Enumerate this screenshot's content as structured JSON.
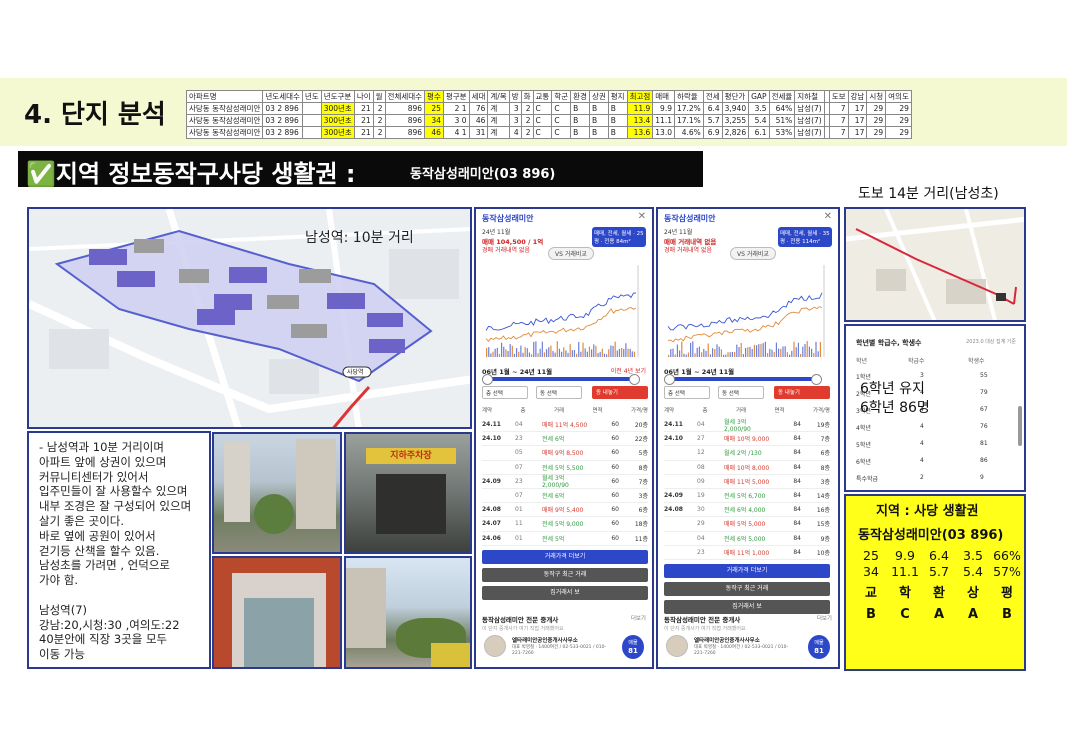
{
  "section_title": "4. 단지 분석",
  "table": {
    "headers": [
      "아파트명",
      "년도세대수",
      "년도",
      "년도구분",
      "나이",
      "월",
      "전체세대수",
      "평수",
      "평구분",
      "세대",
      "계/복",
      "방",
      "화",
      "교통",
      "학군",
      "환경",
      "상권",
      "평지",
      "최고점",
      "매매",
      "하락율",
      "전세",
      "평단가",
      "GAP",
      "전세율",
      "지하철",
      "",
      "도보",
      "강남",
      "시청",
      "여의도"
    ],
    "rows": [
      [
        "사당동 동작삼성래미안",
        "03 2 896",
        "",
        "300년초",
        "21",
        "2",
        "896",
        "25",
        "2 1",
        "76",
        "계",
        "3",
        "2",
        "C",
        "C",
        "B",
        "B",
        "B",
        "11.9",
        "9.9",
        "17.2%",
        "6.4",
        "3,940",
        "3.5",
        "64%",
        "남성(7)",
        "",
        "7",
        "17",
        "29",
        "29"
      ],
      [
        "사당동 동작삼성래미안",
        "03 2 896",
        "",
        "300년초",
        "21",
        "2",
        "896",
        "34",
        "3 0",
        "46",
        "계",
        "3",
        "2",
        "C",
        "C",
        "B",
        "B",
        "B",
        "13.4",
        "11.1",
        "17.1%",
        "5.7",
        "3,255",
        "5.4",
        "51%",
        "남성(7)",
        "",
        "7",
        "17",
        "29",
        "29"
      ],
      [
        "사당동 동작삼성래미안",
        "03 2 896",
        "",
        "300년초",
        "21",
        "2",
        "896",
        "46",
        "4 1",
        "31",
        "계",
        "4",
        "2",
        "C",
        "C",
        "B",
        "B",
        "B",
        "13.6",
        "13.0",
        "4.6%",
        "6.9",
        "2,826",
        "6.1",
        "53%",
        "남성(7)",
        "",
        "7",
        "17",
        "29",
        "29"
      ]
    ]
  },
  "subheader": {
    "main": "✅지역 정보동작구사당 생활권 :",
    "apt": "동작삼성래미안(03 896)"
  },
  "walk_label": "도보 14분 거리(남성초)",
  "map": {
    "station_label": "남성역: 10분 거리",
    "station_tag": "사당역"
  },
  "phones": [
    {
      "title": "동작삼성래미안",
      "date": "24년 11월",
      "price": "매매 104,500 / 1억",
      "sub": "경매 거래내역 없음",
      "pill": "매매, 전세, 월세 · 25평 · 전용 84m²",
      "vs": "VS 거래비교",
      "range": "06년 1월 ~ 24년 11월",
      "range_right": "이전 4년 보기",
      "sel1": "층 선택",
      "sel2": "동 선택",
      "btn": "동 내놓기",
      "thead": [
        "계약",
        "층",
        "거래",
        "면적",
        "가격/평"
      ],
      "rows": [
        [
          "24.11",
          "04",
          "매매 11억 4,500",
          "60",
          "20층"
        ],
        [
          "24.10",
          "23",
          "전세 6억",
          "60",
          "22층"
        ],
        [
          "",
          "05",
          "매매 9억 8,500",
          "60",
          "5층"
        ],
        [
          "",
          "07",
          "전세 5억 5,500",
          "60",
          "8층"
        ],
        [
          "24.09",
          "23",
          "월세 3억 2,000/90",
          "60",
          "7층"
        ],
        [
          "",
          "07",
          "전세 6억",
          "60",
          "3층"
        ],
        [
          "24.08",
          "01",
          "매매 9억 5,400",
          "60",
          "6층"
        ],
        [
          "24.07",
          "11",
          "전세 5억 9,000",
          "60",
          "18층"
        ],
        [
          "24.06",
          "01",
          "전세 5억",
          "60",
          "11층"
        ]
      ],
      "btn1": "거래가격 더보기",
      "btn2": "동작구 최근 거래",
      "btn3": "집거래서 보",
      "agent_title": "동작삼성래미안 전문 중개사",
      "agent_more": "더보기",
      "agent_desc": "이 단지 중개사가 여기 직접 거래했어요",
      "agent_name": "엘타래미안공인중개사사무소",
      "agent_info": "대표 박영철 · 1400여건 / 02-533-0021 / 010-221-7260",
      "badge": "매물",
      "badge_num": "81"
    },
    {
      "title": "동작삼성래미안",
      "date": "24년 11월",
      "price": "매매 거래내역 없음",
      "sub": "경매 거래내역 없음",
      "pill": "매매, 전세, 월세 · 35평 · 전용 114m²",
      "vs": "VS 거래비교",
      "range": "06년 1월 ~ 24년 11월",
      "range_right": "",
      "sel1": "층 선택",
      "sel2": "동 선택",
      "btn": "동 내놓기",
      "thead": [
        "계약",
        "층",
        "거래",
        "면적",
        "가격/평"
      ],
      "rows": [
        [
          "24.11",
          "04",
          "월세 3억 2,000/90",
          "84",
          "19층"
        ],
        [
          "24.10",
          "27",
          "매매 10억 9,000",
          "84",
          "7층"
        ],
        [
          "",
          "12",
          "월세 2억 /130",
          "84",
          "6층"
        ],
        [
          "",
          "08",
          "매매 10억 8,000",
          "84",
          "8층"
        ],
        [
          "",
          "09",
          "매매 11억 5,000",
          "84",
          "3층"
        ],
        [
          "24.09",
          "19",
          "전세 5억 6,700",
          "84",
          "14층"
        ],
        [
          "24.08",
          "30",
          "전세 6억 4,000",
          "84",
          "16층"
        ],
        [
          "",
          "29",
          "매매 5억 5,000",
          "84",
          "15층"
        ],
        [
          "",
          "04",
          "전세 6억 5,000",
          "84",
          "9층"
        ],
        [
          "",
          "23",
          "매매 11억 1,000",
          "84",
          "10층"
        ]
      ],
      "btn1": "거래가격 더보기",
      "btn2": "동작구 최근 거래",
      "btn3": "집거래서 보",
      "agent_title": "동작삼성래미안 전문 중개사",
      "agent_more": "더보기",
      "agent_desc": "이 단지 중개사가 여기 직접 거래했어요",
      "agent_name": "엘타래미안공인중개사사무소",
      "agent_info": "대표 박영철 · 1400여건 / 02-533-0021 / 010-221-7260",
      "badge": "매물",
      "badge_num": "81"
    }
  ],
  "note_lines": [
    "-  남성역과 10분 거리이며",
    "아파트 앞에 상권이 있으며",
    "커뮤니티센터가 있어서",
    " 입주민들이 잘 사용할수 있으며",
    " 내부 조경은 잘 구성되어 있으며",
    "살기 좋은 곳이다.",
    " 바로 옆에 공원이 있어서",
    " 걷기등 산책을 할수 있음.",
    "남성초를 가려면 , 언덕으로",
    " 가야 함.",
    "",
    "남성역(7)",
    "강남:20,시청:30 ,여의도:22",
    " 40분안에 직장 3곳을 모두",
    " 이동 가능"
  ],
  "photo_sign": "지하주차장",
  "school": {
    "title": "학년별 학급수, 학생수",
    "date": "2023.0 대상 집계 기준",
    "headers": [
      "학년",
      "학급수",
      "학생수"
    ],
    "rows": [
      [
        "1학년",
        "3",
        "55"
      ],
      [
        "2학년",
        "4",
        "79"
      ],
      [
        "3학년",
        "4",
        "67"
      ],
      [
        "4학년",
        "4",
        "76"
      ],
      [
        "5학년",
        "4",
        "81"
      ],
      [
        "6학년",
        "4",
        "86"
      ],
      [
        "특수학급",
        "2",
        "9"
      ]
    ],
    "note1": "6학년 유지",
    "note2": "6학년 86명"
  },
  "summary": {
    "title": "지역 : 사당 생활권",
    "apt": "동작삼성래미안(03   896)",
    "row1": [
      "25",
      "9.9",
      "6.4",
      "3.5",
      "66%"
    ],
    "row2": [
      "34",
      "11.1",
      "5.7",
      "5.4",
      "57%"
    ],
    "cats": [
      "교",
      "학",
      "환",
      "상",
      "평"
    ],
    "grades": [
      "B",
      "C",
      "A",
      "A",
      "B"
    ]
  },
  "colors": {
    "accent_blue": "#2d47c9",
    "frame": "#2b3a8f",
    "highlight": "#ffff00",
    "header_band": "#f4f9d2"
  }
}
